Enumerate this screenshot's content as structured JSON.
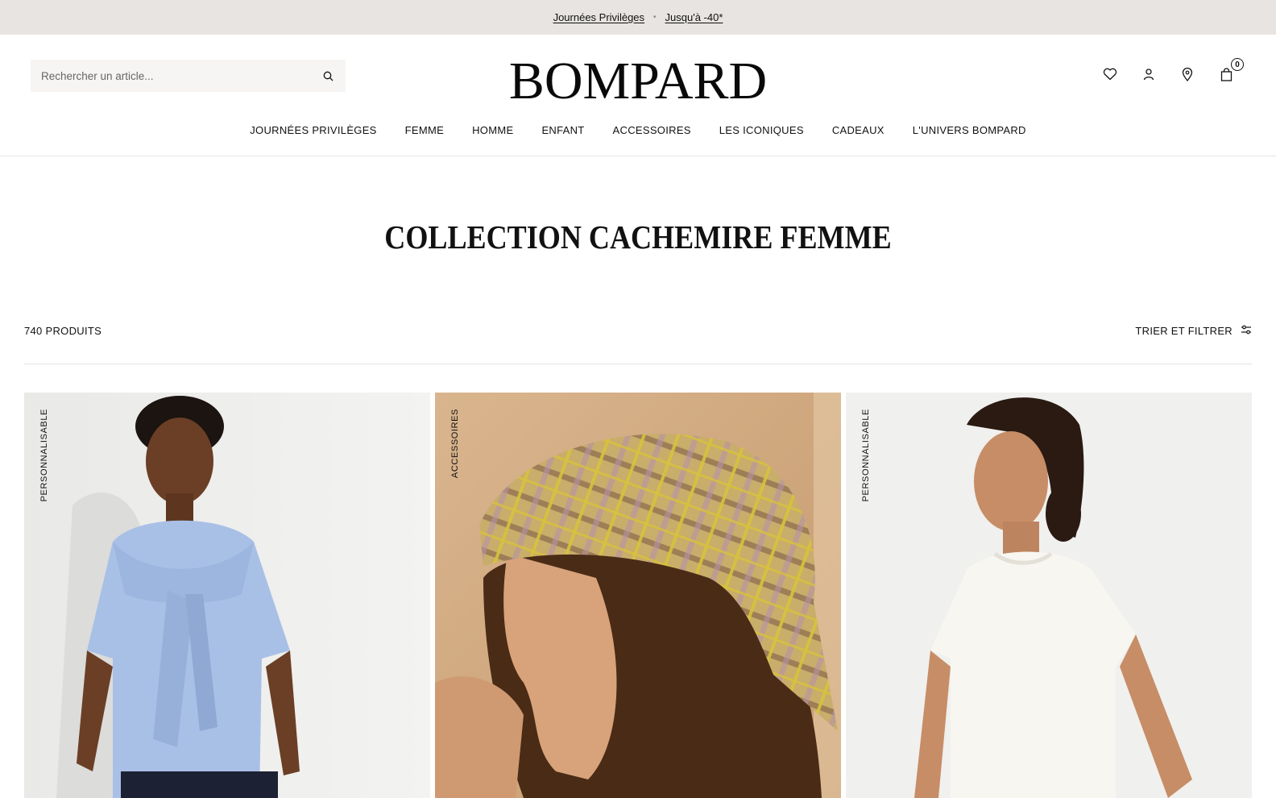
{
  "promo": {
    "link1": "Journées Privilèges",
    "separator": "•",
    "link2": "Jusqu'à -40*"
  },
  "header": {
    "search_placeholder": "Rechercher un article...",
    "logo": "BOMPARD",
    "cart_count": "0",
    "icons": [
      "heart-icon",
      "user-icon",
      "location-pin-icon",
      "bag-icon"
    ]
  },
  "nav": {
    "items": [
      "Journées Privilèges",
      "Femme",
      "Homme",
      "Enfant",
      "Accessoires",
      "Les Iconiques",
      "Cadeaux",
      "L'univers Bompard"
    ]
  },
  "page": {
    "title": "COLLECTION CACHEMIRE FEMME"
  },
  "toolbar": {
    "count": "740 produits",
    "filter_label": "Trier et filtrer"
  },
  "products": [
    {
      "tag": "Personnalisable",
      "image": "woman-in-light-blue-tshirt-with-knotted-sweater"
    },
    {
      "tag": "Accessoires",
      "image": "woman-wearing-plaid-silk-headscarf"
    },
    {
      "tag": "Personnalisable",
      "image": "woman-in-ivory-tshirt"
    }
  ],
  "colors": {
    "promo_bg": "#e7e4e1",
    "search_bg": "#f7f5f3",
    "text": "#111111"
  }
}
